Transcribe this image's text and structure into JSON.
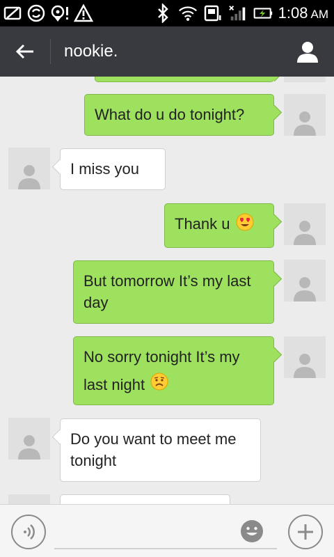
{
  "status_bar": {
    "time": "1:08",
    "ampm": "AM",
    "icons": [
      "screenshot-icon",
      "sync-icon",
      "location-alert-icon",
      "warning-icon",
      "bluetooth-icon",
      "wifi-icon",
      "storage-icon",
      "signal-icon",
      "battery-charging-icon"
    ]
  },
  "header": {
    "title": "nookie.",
    "back_icon": "arrow-left-icon",
    "profile_icon": "person-icon"
  },
  "messages": [
    {
      "direction": "out",
      "text": "What do u do tonight?",
      "emoji": ""
    },
    {
      "direction": "in",
      "text": "I miss you",
      "emoji": ""
    },
    {
      "direction": "out",
      "text": "Thank u",
      "emoji": "heart-eyes-emoji"
    },
    {
      "direction": "out",
      "text": "But tomorrow It’s my last day",
      "emoji": ""
    },
    {
      "direction": "out",
      "text": "No sorry tonight It’s my last night",
      "emoji": "sad-emoji"
    },
    {
      "direction": "in",
      "text": "Do you want to meet me tonight",
      "emoji": ""
    }
  ],
  "input": {
    "value": "",
    "placeholder": ""
  },
  "colors": {
    "outgoing_bubble": "#9de15e",
    "incoming_bubble": "#ffffff",
    "header_bg": "#393a3f",
    "chat_bg": "#ececec"
  }
}
